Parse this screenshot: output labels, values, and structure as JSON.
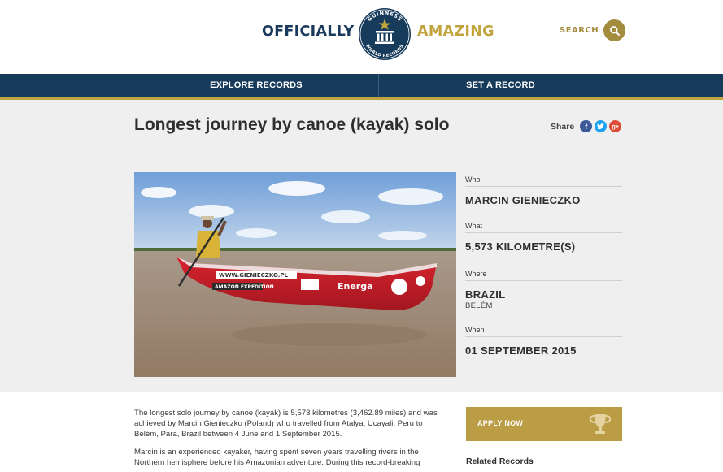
{
  "header": {
    "brand_left": "OFFICIALLY",
    "brand_right": "AMAZING",
    "logo_text_top": "GUINNESS",
    "logo_text_bottom": "WORLD RECORDS",
    "search_label": "SEARCH"
  },
  "nav": {
    "explore": "EXPLORE RECORDS",
    "set": "SET A RECORD"
  },
  "record": {
    "title": "Longest journey by canoe (kayak) solo",
    "share_label": "Share",
    "who_label": "Who",
    "who_value": "MARCIN GIENIECZKO",
    "what_label": "What",
    "what_value": "5,573 KILOMETRE(S)",
    "where_label": "Where",
    "where_value": "BRAZIL",
    "where_sub": "BELÉM",
    "when_label": "When",
    "when_value": "01 SEPTEMBER 2015"
  },
  "photo": {
    "hull_url": "WWW.GIENIECZKO.PL",
    "hull_expedition": "AMAZON EXPEDITION",
    "hull_sponsor": "Energa"
  },
  "body": {
    "para1": "The longest solo journey by canoe (kayak) is 5,573 kilometres (3,462.89 miles) and was achieved by Marcin Gienieczko (Poland) who travelled from Atalya, Ucayali, Peru to Belém, Para, Brazil between 4 June and 1 September 2015.",
    "para2": "Marcin is an experienced kayaker, having spent seven years travelling rivers in the Northern hemisphere before his Amazonian adventure. During this record-breaking"
  },
  "sidebar": {
    "apply_label": "APPLY NOW",
    "related_label": "Related Records"
  },
  "colors": {
    "navy": "#173b5b",
    "gold": "#c2a43f",
    "facebook": "#3b5998",
    "twitter": "#1da1f2",
    "googleplus": "#dd4b39"
  },
  "icons": [
    "search-icon",
    "facebook-icon",
    "twitter-icon",
    "google-plus-icon",
    "trophy-icon"
  ]
}
